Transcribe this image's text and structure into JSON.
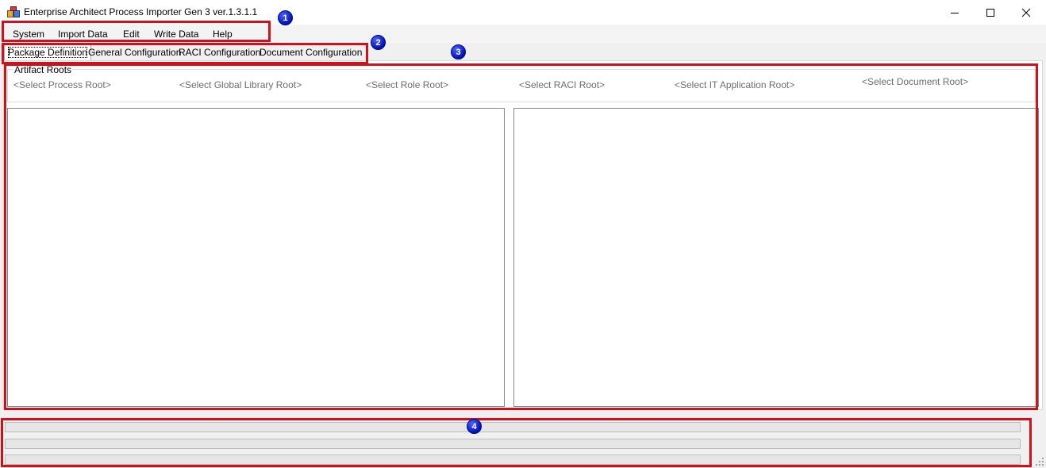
{
  "window": {
    "title": "Enterprise Architect Process Importer Gen 3 ver.1.3.1.1",
    "controls": [
      "minimize-icon",
      "maximize-icon",
      "close-icon"
    ]
  },
  "menu": {
    "items": [
      "System",
      "Import Data",
      "Edit",
      "Write Data",
      "Help"
    ]
  },
  "tabs": {
    "items": [
      "Package Definition",
      "General Configuration",
      "RACI Configuration",
      "Document Configuration"
    ],
    "selected": "Package Definition"
  },
  "artifact_roots": {
    "group_title": "Artifact Roots",
    "links": [
      "<Select Process Root>",
      "<Select Global Library Root>",
      "<Select Role Root>",
      "<Select RACI Root>",
      "<Select IT Application Root>",
      "<Select Document Root>"
    ]
  },
  "annotations": {
    "badges": [
      "1",
      "2",
      "3",
      "4"
    ],
    "color": "#d0101a",
    "badge_color": "#0a1fd0"
  }
}
